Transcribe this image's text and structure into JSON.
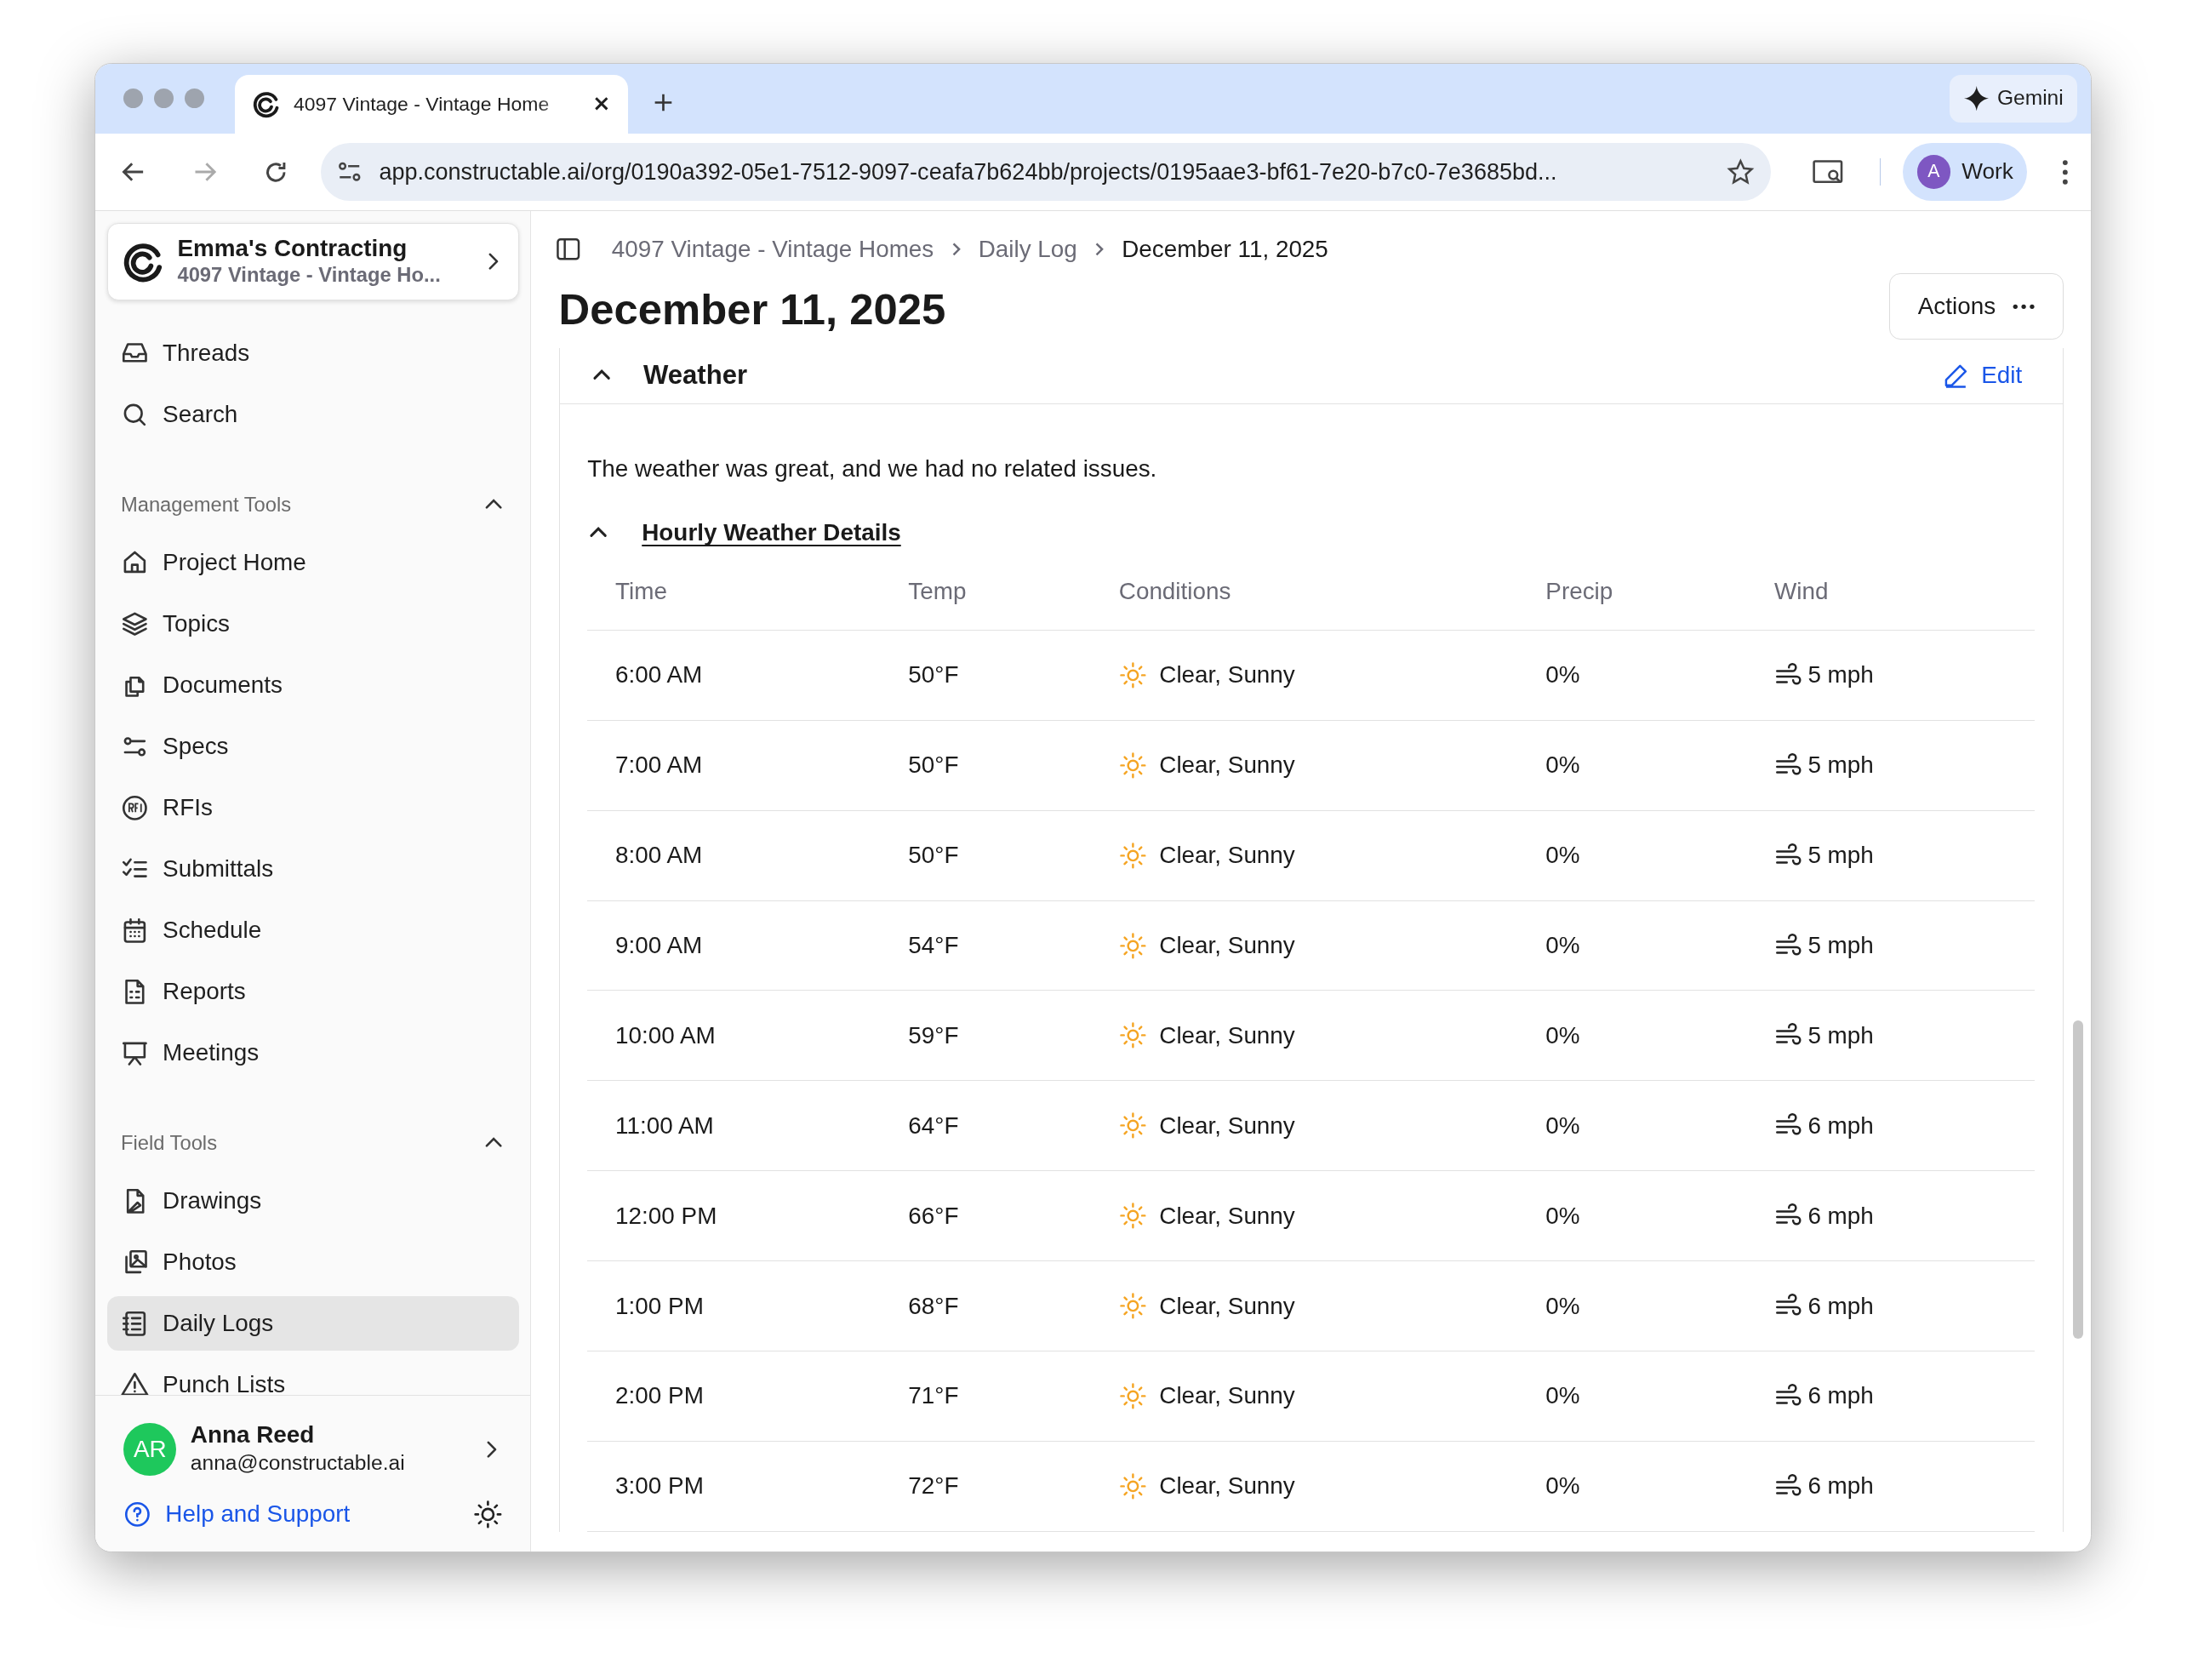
{
  "browser": {
    "tab_title": "4097 Vintage - Vintage Home",
    "url": "app.constructable.ai/org/0190a392-05e1-7512-9097-ceafa7b624bb/projects/0195aae3-bf61-7e20-b7c0-7e3685bd...",
    "gemini": "Gemini",
    "profile_initial": "A",
    "profile": "Work"
  },
  "sidebar": {
    "org": "Emma's Contracting",
    "project": "4097 Vintage - Vintage Ho...",
    "top_items": [
      {
        "label": "Threads",
        "selected": false
      },
      {
        "label": "Search",
        "selected": false
      }
    ],
    "sections": [
      {
        "title": "Management Tools",
        "expanded": true,
        "items": [
          {
            "label": "Project Home",
            "selected": false
          },
          {
            "label": "Topics",
            "selected": false
          },
          {
            "label": "Documents",
            "selected": false
          },
          {
            "label": "Specs",
            "selected": false
          },
          {
            "label": "RFIs",
            "selected": false
          },
          {
            "label": "Submittals",
            "selected": false
          },
          {
            "label": "Schedule",
            "selected": false
          },
          {
            "label": "Reports",
            "selected": false
          },
          {
            "label": "Meetings",
            "selected": false
          }
        ]
      },
      {
        "title": "Field Tools",
        "expanded": true,
        "items": [
          {
            "label": "Drawings",
            "selected": false
          },
          {
            "label": "Photos",
            "selected": false
          },
          {
            "label": "Daily Logs",
            "selected": true
          },
          {
            "label": "Punch Lists",
            "selected": false
          }
        ]
      }
    ],
    "user": {
      "initials": "AR",
      "name": "Anna Reed",
      "email": "anna@constructable.ai"
    },
    "help": "Help and Support"
  },
  "breadcrumbs": [
    "4097 Vintage - Vintage Homes",
    "Daily Log",
    "December 11, 2025"
  ],
  "title": "December 11, 2025",
  "actions": "Actions",
  "weather": {
    "title": "Weather",
    "expanded": true,
    "edit": "Edit",
    "summary": "The weather was great, and we had no related issues.",
    "details_title": "Hourly Weather Details",
    "details_expanded": true,
    "columns": [
      "Time",
      "Temp",
      "Conditions",
      "Precip",
      "Wind"
    ],
    "rows": [
      {
        "time": "6:00 AM",
        "temp": "50°F",
        "conditions": "Clear, Sunny",
        "precip": "0%",
        "wind": "5 mph"
      },
      {
        "time": "7:00 AM",
        "temp": "50°F",
        "conditions": "Clear, Sunny",
        "precip": "0%",
        "wind": "5 mph"
      },
      {
        "time": "8:00 AM",
        "temp": "50°F",
        "conditions": "Clear, Sunny",
        "precip": "0%",
        "wind": "5 mph"
      },
      {
        "time": "9:00 AM",
        "temp": "54°F",
        "conditions": "Clear, Sunny",
        "precip": "0%",
        "wind": "5 mph"
      },
      {
        "time": "10:00 AM",
        "temp": "59°F",
        "conditions": "Clear, Sunny",
        "precip": "0%",
        "wind": "5 mph"
      },
      {
        "time": "11:00 AM",
        "temp": "64°F",
        "conditions": "Clear, Sunny",
        "precip": "0%",
        "wind": "6 mph"
      },
      {
        "time": "12:00 PM",
        "temp": "66°F",
        "conditions": "Clear, Sunny",
        "precip": "0%",
        "wind": "6 mph"
      },
      {
        "time": "1:00 PM",
        "temp": "68°F",
        "conditions": "Clear, Sunny",
        "precip": "0%",
        "wind": "6 mph"
      },
      {
        "time": "2:00 PM",
        "temp": "71°F",
        "conditions": "Clear, Sunny",
        "precip": "0%",
        "wind": "6 mph"
      },
      {
        "time": "3:00 PM",
        "temp": "72°F",
        "conditions": "Clear, Sunny",
        "precip": "0%",
        "wind": "6 mph"
      }
    ]
  }
}
